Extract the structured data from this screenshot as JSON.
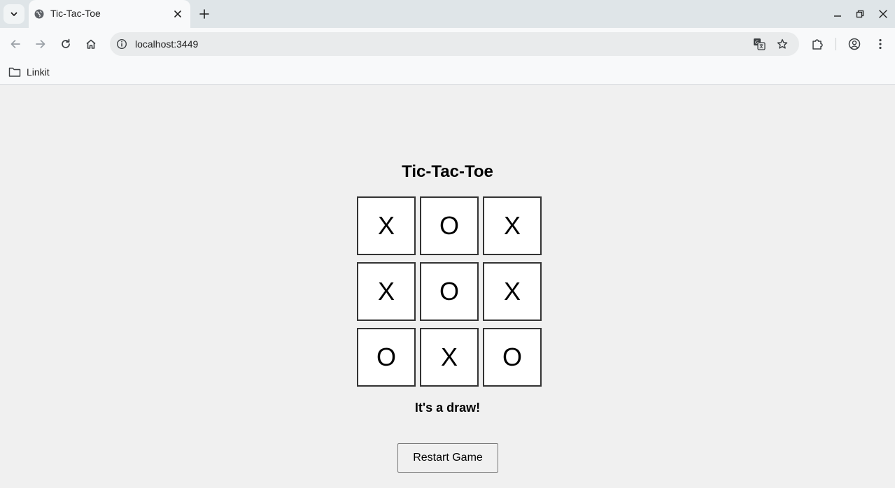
{
  "browser": {
    "tab": {
      "title": "Tic-Tac-Toe"
    },
    "address": {
      "url": "localhost:3449"
    },
    "bookmarks": [
      {
        "label": "Linkit"
      }
    ]
  },
  "game": {
    "title": "Tic-Tac-Toe",
    "board": [
      "X",
      "O",
      "X",
      "X",
      "O",
      "X",
      "O",
      "X",
      "O"
    ],
    "status": "It's a draw!",
    "restart_label": "Restart Game"
  },
  "icons": {
    "tab_search": "chevron-down-icon",
    "favicon": "globe-icon",
    "tab_close": "close-icon",
    "new_tab": "plus-icon",
    "back": "arrow-left-icon",
    "forward": "arrow-right-icon",
    "reload": "reload-icon",
    "home": "home-icon",
    "site_info": "info-icon",
    "translate": "translate-icon",
    "bookmark": "star-icon",
    "extensions": "puzzle-icon",
    "profile": "account-icon",
    "menu": "kebab-menu-icon",
    "folder": "folder-icon"
  },
  "colors": {
    "tabstrip": "#dfe5e8",
    "toolbar": "#f8f9fa",
    "page_bg": "#f0f0f0",
    "cell_border": "#333333"
  }
}
